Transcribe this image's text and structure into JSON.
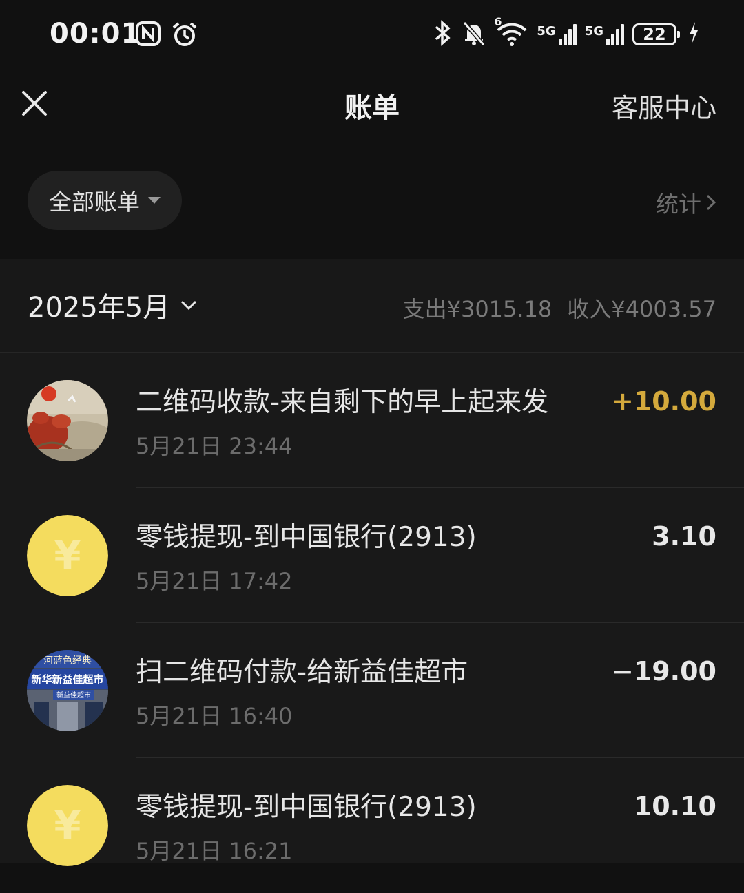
{
  "status_bar": {
    "time": "00:01",
    "left_icons": [
      "nfc-icon",
      "alarm-icon"
    ],
    "right_icons": [
      "bluetooth-icon",
      "mute-icon",
      "wifi-icon"
    ],
    "wifi_badge": "6",
    "signal_1_label": "5G",
    "signal_2_label": "5G",
    "battery": "22",
    "charging_icon": "lightning-icon"
  },
  "nav": {
    "title": "账单",
    "close_icon": "close-icon",
    "service_label": "客服中心"
  },
  "filter": {
    "label": "全部账单",
    "stats_label": "统计"
  },
  "month": {
    "label": "2025年5月",
    "expense": "支出¥3015.18",
    "income": "收入¥4003.57"
  },
  "colors": {
    "background": "#111111",
    "income_amount": "#d4a93c",
    "coin": "#f4dc5e"
  },
  "transactions": [
    {
      "title": "二维码收款-来自剩下的早上起来发",
      "time": "5月21日 23:44",
      "amount": "+10.00",
      "avatar": "painting-avatar"
    },
    {
      "title": "零钱提现-到中国银行(2913)",
      "time": "5月21日 17:42",
      "amount": "3.10",
      "avatar": "yuan-coin-icon",
      "coin_symbol": "¥"
    },
    {
      "title": "扫二维码付款-给新益佳超市",
      "time": "5月21日 16:40",
      "amount": "−19.00",
      "avatar": "store-photo-avatar",
      "store_sign_top": "河蓝色经典",
      "store_sign_main": "新华新益佳超市",
      "store_sign_small": "新益佳超市"
    },
    {
      "title": "零钱提现-到中国银行(2913)",
      "time": "5月21日 16:21",
      "amount": "10.10",
      "avatar": "yuan-coin-icon",
      "coin_symbol": "¥"
    }
  ]
}
